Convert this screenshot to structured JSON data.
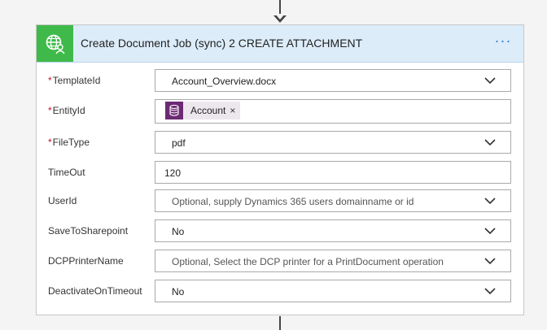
{
  "card": {
    "title": "Create Document Job (sync) 2 CREATE ATTACHMENT",
    "header_icon": "globe-person-icon",
    "menu_label": "···",
    "accent_color": "#3fba4a",
    "header_bg": "#dcecf9"
  },
  "fields": {
    "template_id": {
      "label": "TemplateId",
      "required": true,
      "value": "Account_Overview.docx",
      "type": "dropdown"
    },
    "entity_id": {
      "label": "EntityId",
      "required": true,
      "token_label": "Account",
      "token_icon": "database-icon",
      "token_color": "#6c2a73",
      "remove": "×",
      "type": "token"
    },
    "file_type": {
      "label": "FileType",
      "required": true,
      "value": "pdf",
      "type": "dropdown"
    },
    "timeout": {
      "label": "TimeOut",
      "required": false,
      "value": "120",
      "type": "text"
    },
    "user_id": {
      "label": "UserId",
      "required": false,
      "placeholder": "Optional, supply Dynamics 365 users domainname or id",
      "type": "dropdown"
    },
    "save_to_sharepoint": {
      "label": "SaveToSharepoint",
      "required": false,
      "value": "No",
      "type": "dropdown"
    },
    "dcp_printer_name": {
      "label": "DCPPrinterName",
      "required": false,
      "placeholder": "Optional, Select the DCP printer for a PrintDocument operation",
      "type": "dropdown"
    },
    "deactivate_on_timeout": {
      "label": "DeactivateOnTimeout",
      "required": false,
      "value": "No",
      "type": "dropdown"
    }
  },
  "required_marker": "*"
}
